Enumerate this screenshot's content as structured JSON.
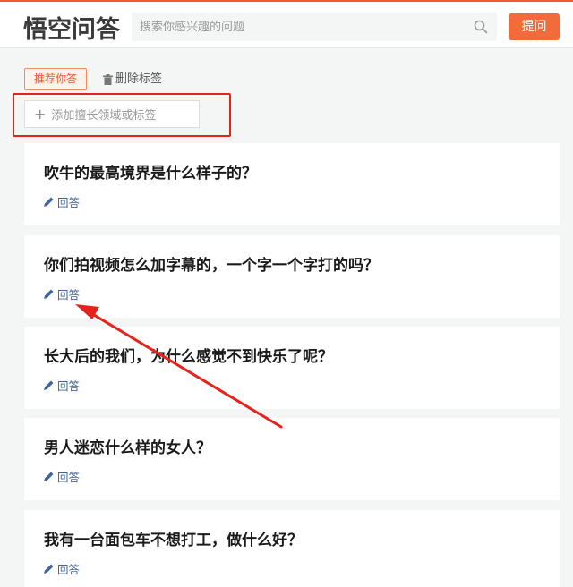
{
  "header": {
    "logo_text": "悟空问答",
    "search_placeholder": "搜索你感兴趣的问题",
    "ask_label": "提问"
  },
  "filters": {
    "recommend_tag": "推荐你答",
    "delete_tag": "删除标签",
    "add_field_label": "添加擅长领域或标签"
  },
  "questions": [
    {
      "title": "吹牛的最高境界是什么样子的？",
      "answer_label": "回答"
    },
    {
      "title": "你们拍视频怎么加字幕的，一个字一个字打的吗？",
      "answer_label": "回答"
    },
    {
      "title": "长大后的我们，为什么感觉不到快乐了呢？",
      "answer_label": "回答"
    },
    {
      "title": "男人迷恋什么样的女人？",
      "answer_label": "回答"
    },
    {
      "title": "我有一台面包车不想打工，做什么好？",
      "answer_label": "回答"
    }
  ],
  "colors": {
    "brand": "#f25a2b",
    "annotation_red": "#e3231c",
    "link_blue": "#406599"
  },
  "icons": [
    "search-icon",
    "trash-icon",
    "plus-icon",
    "pencil-icon",
    "annotation-arrow"
  ]
}
